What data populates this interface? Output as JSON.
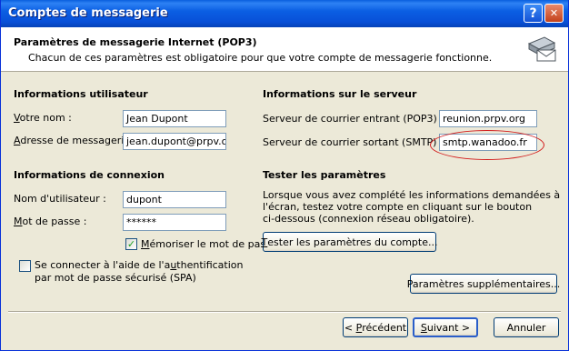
{
  "window": {
    "title": "Comptes de messagerie",
    "help_glyph": "?",
    "close_glyph": "✕"
  },
  "header": {
    "title": "Paramètres de messagerie Internet (POP3)",
    "description": "Chacun de ces paramètres est obligatoire pour que votre compte de messagerie fonctionne.",
    "icon": "mail-account-icon"
  },
  "user_info": {
    "heading": "Informations utilisateur",
    "name_label_first": "V",
    "name_label_rest": "otre nom :",
    "name_value": "Jean Dupont",
    "email_label_first": "A",
    "email_label_rest": "dresse de messagerie :",
    "email_value": "jean.dupont@prpv.org"
  },
  "server_info": {
    "heading": "Informations sur le serveur",
    "incoming_label": "Serveur de courrier entrant (POP3) :",
    "incoming_value": "reunion.prpv.org",
    "outgoing_label": "Serveur de courrier sortant (SMTP) :",
    "outgoing_value": "smtp.wanadoo.fr"
  },
  "logon_info": {
    "heading": "Informations de connexion",
    "username_label": "Nom d'utilisateur :",
    "username_value": "dupont",
    "password_label_first": "M",
    "password_label_rest": "ot de passe :",
    "password_value": "******",
    "remember_first": "M",
    "remember_rest": "émoriser le mot de passe",
    "remember_checked": true,
    "spa_line1_a": "Se connecter à l'aide de l'a",
    "spa_line1_u": "u",
    "spa_line1_b": "thentification",
    "spa_line2": "par mot de passe sécurisé (SPA)",
    "spa_checked": false
  },
  "test": {
    "heading": "Tester les paramètres",
    "line1": "Lorsque vous avez complété les informations demandées à",
    "line2": "l'écran, testez votre compte en cliquant sur le bouton",
    "line3": "ci-dessous (connexion réseau obligatoire).",
    "button_first": "T",
    "button_rest": "ester les paramètres du compte..."
  },
  "more_settings_label": "Paramètres supplémentaires...",
  "footer": {
    "prev_glyph": "<",
    "prev_first": "P",
    "prev_rest": "récédent",
    "next_first": "S",
    "next_rest": "uivant",
    "next_glyph": ">",
    "cancel": "Annuler"
  },
  "colors": {
    "title_bar": "#0b5fe3",
    "annotation": "#d21e1e",
    "checkmark": "#21a121"
  }
}
